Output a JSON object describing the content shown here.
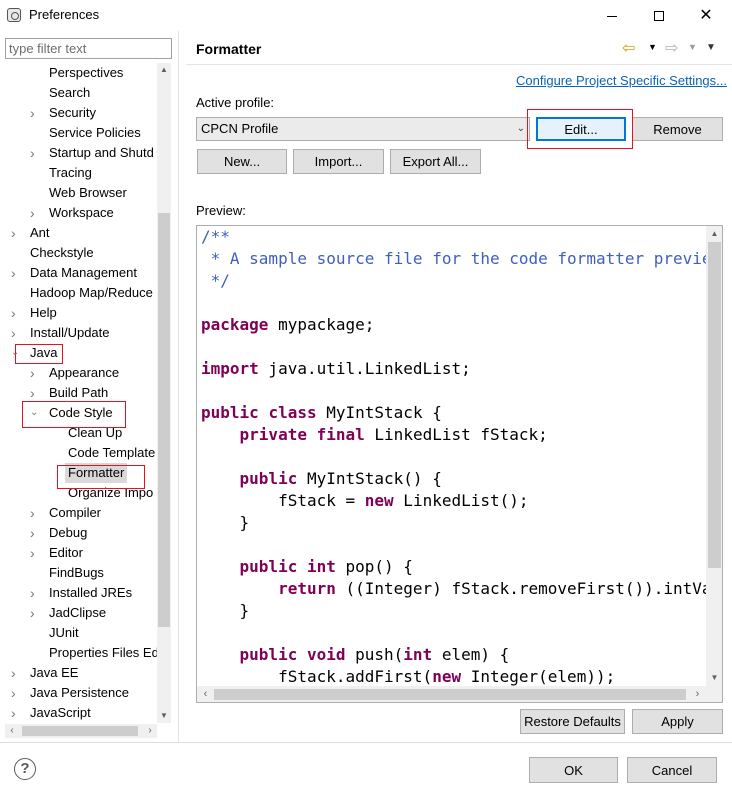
{
  "window": {
    "title": "Preferences",
    "controls": {
      "minimize": "minimize-icon",
      "maximize": "maximize-icon",
      "close": "✕"
    }
  },
  "filter": {
    "placeholder": "type filter text"
  },
  "tree": [
    {
      "label": "Perspectives",
      "level": 2,
      "twisty": "none"
    },
    {
      "label": "Search",
      "level": 2,
      "twisty": "none"
    },
    {
      "label": "Security",
      "level": 2,
      "twisty": "collapsed"
    },
    {
      "label": "Service Policies",
      "level": 2,
      "twisty": "none"
    },
    {
      "label": "Startup and Shutd",
      "level": 2,
      "twisty": "collapsed"
    },
    {
      "label": "Tracing",
      "level": 2,
      "twisty": "none"
    },
    {
      "label": "Web Browser",
      "level": 2,
      "twisty": "none"
    },
    {
      "label": "Workspace",
      "level": 2,
      "twisty": "collapsed"
    },
    {
      "label": "Ant",
      "level": 1,
      "twisty": "collapsed"
    },
    {
      "label": "Checkstyle",
      "level": 1,
      "twisty": "none"
    },
    {
      "label": "Data Management",
      "level": 1,
      "twisty": "collapsed"
    },
    {
      "label": "Hadoop Map/Reduce",
      "level": 1,
      "twisty": "none"
    },
    {
      "label": "Help",
      "level": 1,
      "twisty": "collapsed"
    },
    {
      "label": "Install/Update",
      "level": 1,
      "twisty": "collapsed"
    },
    {
      "label": "Java",
      "level": 1,
      "twisty": "expanded"
    },
    {
      "label": "Appearance",
      "level": 2,
      "twisty": "collapsed"
    },
    {
      "label": "Build Path",
      "level": 2,
      "twisty": "collapsed"
    },
    {
      "label": "Code Style",
      "level": 2,
      "twisty": "expanded"
    },
    {
      "label": "Clean Up",
      "level": 3,
      "twisty": "none"
    },
    {
      "label": "Code Template",
      "level": 3,
      "twisty": "none"
    },
    {
      "label": "Formatter",
      "level": 3,
      "twisty": "none",
      "selected": true
    },
    {
      "label": "Organize Impo",
      "level": 3,
      "twisty": "none"
    },
    {
      "label": "Compiler",
      "level": 2,
      "twisty": "collapsed"
    },
    {
      "label": "Debug",
      "level": 2,
      "twisty": "collapsed"
    },
    {
      "label": "Editor",
      "level": 2,
      "twisty": "collapsed"
    },
    {
      "label": "FindBugs",
      "level": 2,
      "twisty": "none"
    },
    {
      "label": "Installed JREs",
      "level": 2,
      "twisty": "collapsed"
    },
    {
      "label": "JadClipse",
      "level": 2,
      "twisty": "collapsed"
    },
    {
      "label": "JUnit",
      "level": 2,
      "twisty": "none"
    },
    {
      "label": "Properties Files Ed",
      "level": 2,
      "twisty": "none"
    },
    {
      "label": "Java EE",
      "level": 1,
      "twisty": "collapsed"
    },
    {
      "label": "Java Persistence",
      "level": 1,
      "twisty": "collapsed"
    },
    {
      "label": "JavaScript",
      "level": 1,
      "twisty": "collapsed"
    }
  ],
  "page": {
    "title": "Formatter",
    "nav": {
      "back": "back-arrow-icon",
      "forward": "forward-arrow-icon",
      "menu": "view-menu-icon"
    },
    "config_link": "Configure Project Specific Settings...",
    "active_profile_label": "Active profile:",
    "profile_selected": "CPCN Profile",
    "buttons": {
      "edit": "Edit...",
      "remove": "Remove",
      "new": "New...",
      "import": "Import...",
      "export_all": "Export All...",
      "restore_defaults": "Restore Defaults",
      "apply": "Apply"
    },
    "preview_label": "Preview:",
    "code_lines": [
      [
        {
          "t": "/**",
          "c": "cm"
        }
      ],
      [
        {
          "t": " * A sample source file for the code formatter preview",
          "c": "cm"
        }
      ],
      [
        {
          "t": " */",
          "c": "cm"
        }
      ],
      [],
      [
        {
          "t": "package",
          "c": "kw"
        },
        {
          "t": " mypackage;",
          "c": ""
        }
      ],
      [],
      [
        {
          "t": "import",
          "c": "kw"
        },
        {
          "t": " java.util.LinkedList;",
          "c": ""
        }
      ],
      [],
      [
        {
          "t": "public",
          "c": "kw"
        },
        {
          "t": " ",
          "c": ""
        },
        {
          "t": "class",
          "c": "kw"
        },
        {
          "t": " MyIntStack {",
          "c": ""
        }
      ],
      [
        {
          "t": "    ",
          "c": ""
        },
        {
          "t": "private",
          "c": "kw"
        },
        {
          "t": " ",
          "c": ""
        },
        {
          "t": "final",
          "c": "kw"
        },
        {
          "t": " LinkedList fStack;",
          "c": ""
        }
      ],
      [],
      [
        {
          "t": "    ",
          "c": ""
        },
        {
          "t": "public",
          "c": "kw"
        },
        {
          "t": " MyIntStack() {",
          "c": ""
        }
      ],
      [
        {
          "t": "        fStack = ",
          "c": ""
        },
        {
          "t": "new",
          "c": "kw"
        },
        {
          "t": " LinkedList();",
          "c": ""
        }
      ],
      [
        {
          "t": "    }",
          "c": ""
        }
      ],
      [],
      [
        {
          "t": "    ",
          "c": ""
        },
        {
          "t": "public",
          "c": "kw"
        },
        {
          "t": " ",
          "c": ""
        },
        {
          "t": "int",
          "c": "kw"
        },
        {
          "t": " pop() {",
          "c": ""
        }
      ],
      [
        {
          "t": "        ",
          "c": ""
        },
        {
          "t": "return",
          "c": "kw"
        },
        {
          "t": " ((Integer) fStack.removeFirst()).intValue();",
          "c": ""
        }
      ],
      [
        {
          "t": "    }",
          "c": ""
        }
      ],
      [],
      [
        {
          "t": "    ",
          "c": ""
        },
        {
          "t": "public",
          "c": "kw"
        },
        {
          "t": " ",
          "c": ""
        },
        {
          "t": "void",
          "c": "kw"
        },
        {
          "t": " push(",
          "c": ""
        },
        {
          "t": "int",
          "c": "kw"
        },
        {
          "t": " elem) {",
          "c": ""
        }
      ],
      [
        {
          "t": "        fStack.addFirst(",
          "c": ""
        },
        {
          "t": "new",
          "c": "kw"
        },
        {
          "t": " Integer(elem));",
          "c": ""
        }
      ]
    ]
  },
  "footer": {
    "help": "?",
    "ok": "OK",
    "cancel": "Cancel"
  },
  "colors": {
    "keyword": "#7f0055",
    "comment": "#3f5fbf",
    "link": "#0b63b5",
    "callout": "#e81123"
  }
}
